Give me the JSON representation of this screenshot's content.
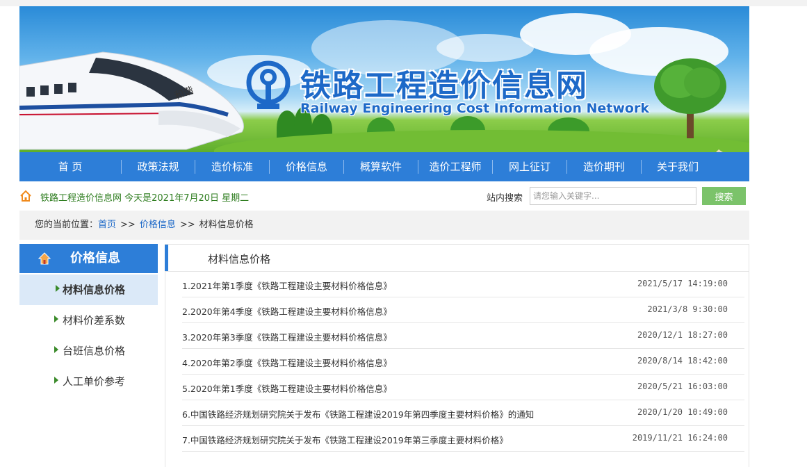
{
  "site": {
    "title": "铁路工程造价信息网",
    "subtitle": "Railway Engineering Cost Information Network",
    "train_label": "和谐"
  },
  "nav": {
    "items": [
      "首 页",
      "政策法规",
      "造价标准",
      "价格信息",
      "概算软件",
      "造价工程师",
      "网上征订",
      "造价期刊",
      "关于我们"
    ]
  },
  "infobar": {
    "welcome": "铁路工程造价信息网  今天是2021年7月20日  星期二",
    "search_label": "站内搜索",
    "search_placeholder": "请您输入关键字...",
    "search_button": "搜索"
  },
  "breadcrumb": {
    "prefix": "您的当前位置：",
    "home": "首页",
    "section": "价格信息",
    "current": "材料信息价格",
    "sep": ">>"
  },
  "sidebar": {
    "title": "价格信息",
    "items": [
      {
        "label": "材料信息价格",
        "active": true
      },
      {
        "label": "材料价差系数",
        "active": false
      },
      {
        "label": "台班信息价格",
        "active": false
      },
      {
        "label": "人工单价参考",
        "active": false
      }
    ]
  },
  "main": {
    "title": "材料信息价格",
    "rows": [
      {
        "title": "1.2021年第1季度《铁路工程建设主要材料价格信息》",
        "date": "2021/5/17 14:19:00"
      },
      {
        "title": "2.2020年第4季度《铁路工程建设主要材料价格信息》",
        "date": "2021/3/8 9:30:00"
      },
      {
        "title": "3.2020年第3季度《铁路工程建设主要材料价格信息》",
        "date": "2020/12/1 18:27:00"
      },
      {
        "title": "4.2020年第2季度《铁路工程建设主要材料价格信息》",
        "date": "2020/8/14 18:42:00"
      },
      {
        "title": "5.2020年第1季度《铁路工程建设主要材料价格信息》",
        "date": "2020/5/21 16:03:00"
      },
      {
        "title": "6.中国铁路经济规划研究院关于发布《铁路工程建设2019年第四季度主要材料价格》的通知",
        "date": "2020/1/20 10:49:00"
      },
      {
        "title": "7.中国铁路经济规划研究院关于发布《铁路工程建设2019年第三季度主要材料价格》",
        "date": "2019/11/21 16:24:00"
      }
    ]
  },
  "colors": {
    "nav_blue": "#2d7ed8",
    "title_blue": "#1d69c8",
    "welcome_green": "#2e7d1f",
    "search_green": "#7bc36a",
    "active_bg": "#dbe9f8"
  }
}
